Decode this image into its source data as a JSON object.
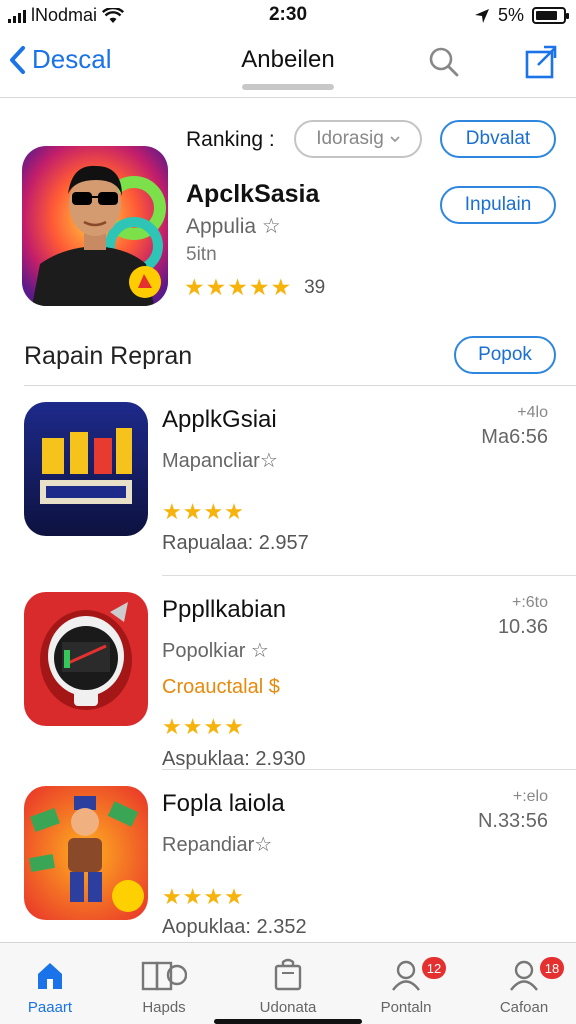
{
  "status_bar": {
    "carrier": "lNodmai",
    "time": "2:30",
    "battery": "5%"
  },
  "nav": {
    "back_label": "Descal",
    "title": "Anbeilen"
  },
  "featured": {
    "ranking_label": "Ranking :",
    "ranking_select": "Idorasig",
    "button_primary": "Dbvalat",
    "button_secondary": "Inpulain",
    "title": "ApclkSasia",
    "subtitle": "Appulia ☆",
    "subtitle2": "5itn",
    "stars": "★★★★★",
    "rating_count": "39"
  },
  "section": {
    "title": "Rapain Repran",
    "button": "Popok"
  },
  "list": [
    {
      "name": "ApplkGsiai",
      "sub": "Mapancliar☆",
      "promo": "",
      "stars": "★★★★",
      "rating": "Rapualaa: 2.957",
      "meta1": "+4lo",
      "meta2": "Ma6:56"
    },
    {
      "name": "Pppllkabian",
      "sub": "Popolkiar ☆",
      "promo": "Croauctalal $",
      "stars": "★★★★",
      "rating": "Aspuklaa: 2.930",
      "meta1": "+:6to",
      "meta2": "10.36"
    },
    {
      "name": "Fopla laiola",
      "sub": "Repandiar☆",
      "promo": "",
      "stars": "★★★★",
      "rating": "Aopuklaa: 2.352",
      "meta1": "+:elo",
      "meta2": "N.33:56"
    }
  ],
  "tabs": [
    {
      "label": "Paaart",
      "icon": "home-icon",
      "badge": ""
    },
    {
      "label": "Hapds",
      "icon": "books-icon",
      "badge": ""
    },
    {
      "label": "Udonata",
      "icon": "bag-icon",
      "badge": ""
    },
    {
      "label": "Pontaln",
      "icon": "person-icon",
      "badge": "12"
    },
    {
      "label": "Cafoan",
      "icon": "person-icon",
      "badge": "18"
    }
  ],
  "colors": {
    "accent": "#1a73e8",
    "star": "#f5b30c",
    "promo": "#e8890c",
    "badge": "#e53030"
  }
}
